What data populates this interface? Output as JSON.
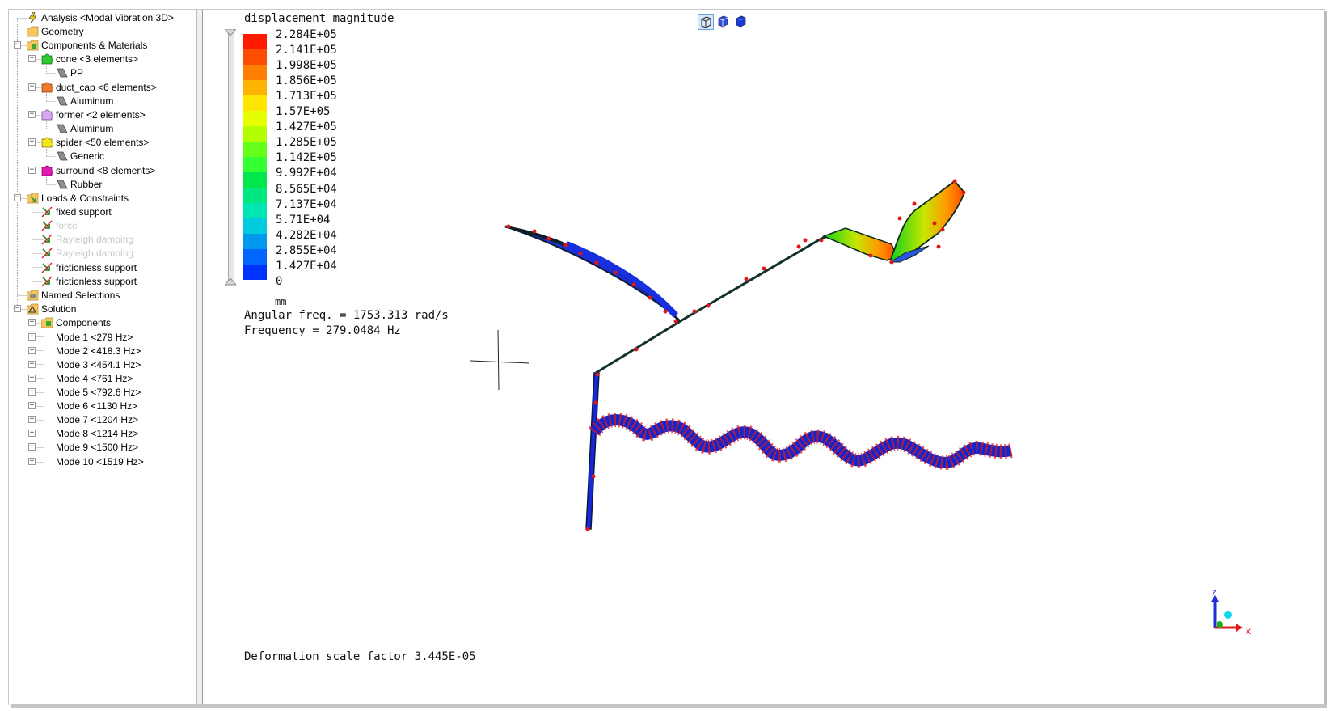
{
  "tree": {
    "items": [
      {
        "label": "Analysis <Modal Vibration 3D>",
        "icon": "analysis-icon"
      },
      {
        "label": "Geometry",
        "icon": "folder-icon"
      },
      {
        "label": "Components & Materials",
        "icon": "components-icon"
      },
      {
        "label": "cone <3 elements>",
        "icon": "puzzle-green-icon"
      },
      {
        "label": "PP",
        "icon": "material-icon"
      },
      {
        "label": "duct_cap <6 elements>",
        "icon": "puzzle-orange-icon"
      },
      {
        "label": "Aluminum",
        "icon": "material-icon"
      },
      {
        "label": "former <2 elements>",
        "icon": "puzzle-lavender-icon"
      },
      {
        "label": "Aluminum",
        "icon": "material-icon"
      },
      {
        "label": "spider <50 elements>",
        "icon": "puzzle-yellow-icon"
      },
      {
        "label": "Generic",
        "icon": "material-icon"
      },
      {
        "label": "surround <8 elements>",
        "icon": "puzzle-magenta-icon"
      },
      {
        "label": "Rubber",
        "icon": "material-icon"
      },
      {
        "label": "Loads & Constraints",
        "icon": "loads-folder-icon"
      },
      {
        "label": "fixed support",
        "icon": "constraint-icon"
      },
      {
        "label": "force",
        "icon": "constraint-icon",
        "disabled": true
      },
      {
        "label": "Rayleigh damping",
        "icon": "constraint-icon",
        "disabled": true
      },
      {
        "label": "Rayleigh damping",
        "icon": "constraint-icon",
        "disabled": true
      },
      {
        "label": "frictionless support",
        "icon": "constraint-icon"
      },
      {
        "label": "frictionless support",
        "icon": "constraint-icon"
      },
      {
        "label": "Named Selections",
        "icon": "named-selection-icon"
      },
      {
        "label": "Solution",
        "icon": "solution-icon"
      },
      {
        "label": "Components",
        "icon": "components-icon"
      },
      {
        "label": "Mode 1 <279 Hz>"
      },
      {
        "label": "Mode 2 <418.3 Hz>"
      },
      {
        "label": "Mode 3 <454.1 Hz>"
      },
      {
        "label": "Mode 4 <761 Hz>"
      },
      {
        "label": "Mode 5 <792.6 Hz>"
      },
      {
        "label": "Mode 6 <1130 Hz>"
      },
      {
        "label": "Mode 7 <1204 Hz>"
      },
      {
        "label": "Mode 8 <1214 Hz>"
      },
      {
        "label": "Mode 9 <1500 Hz>"
      },
      {
        "label": "Mode 10 <1519 Hz>"
      }
    ]
  },
  "toolbar": {
    "buttons": [
      {
        "name": "wireframe-view-button",
        "icon": "cube-wireframe-icon",
        "active": true
      },
      {
        "name": "shaded-view-button",
        "icon": "cube-shaded-icon"
      },
      {
        "name": "solid-view-button",
        "icon": "cube-solid-icon"
      }
    ]
  },
  "viewport": {
    "legend_title": "displacement magnitude",
    "legend_values": [
      "2.284E+05",
      "2.141E+05",
      "1.998E+05",
      "1.856E+05",
      "1.713E+05",
      "1.57E+05",
      "1.427E+05",
      "1.285E+05",
      "1.142E+05",
      "9.992E+04",
      "8.565E+04",
      "7.137E+04",
      "5.71E+04",
      "4.282E+04",
      "2.855E+04",
      "1.427E+04",
      "0"
    ],
    "legend_colors": [
      "#ff1a00",
      "#ff4d00",
      "#ff8000",
      "#ffb300",
      "#ffe600",
      "#e6ff00",
      "#b3ff00",
      "#66ff1a",
      "#33ff33",
      "#00e64d",
      "#00e680",
      "#00e6b3",
      "#00ccdd",
      "#0099ee",
      "#0066ff",
      "#0033ff"
    ],
    "unit": "mm",
    "angular_freq": "Angular freq. = 1753.313 rad/s",
    "frequency": "Frequency = 279.0484 Hz",
    "scale_factor": "Deformation scale factor 3.445E-05",
    "axes": {
      "z": "z",
      "x": "x"
    }
  }
}
